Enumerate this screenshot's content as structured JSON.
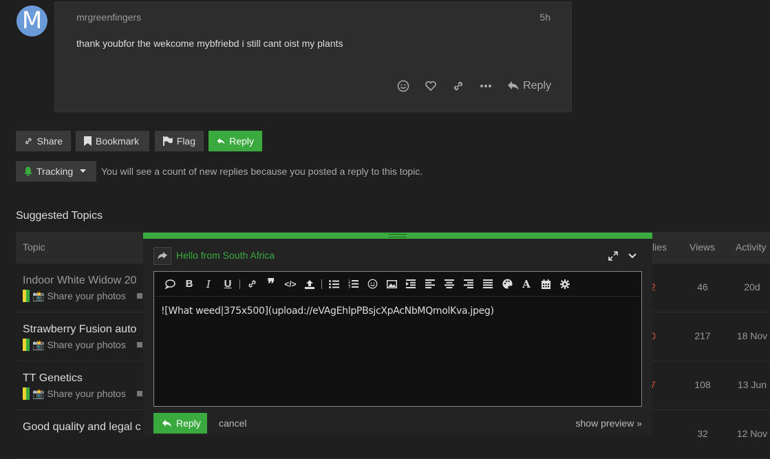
{
  "post": {
    "avatar_letter": "M",
    "username": "mrgreenfingers",
    "age": "5h",
    "body": "thank youbfor the wekcome mybfriebd i still cant oist my plants",
    "reply_label": "Reply"
  },
  "topic_buttons": {
    "share": "Share",
    "bookmark": "Bookmark",
    "flag": "Flag",
    "reply": "Reply"
  },
  "tracking": {
    "label": "Tracking",
    "note": "You will see a count of new replies because you posted a reply to this topic."
  },
  "suggested_title": "Suggested Topics",
  "table": {
    "headers": {
      "topic": "Topic",
      "replies": "lies",
      "views": "Views",
      "activity": "Activity"
    },
    "rows": [
      {
        "title": "Indoor White Widow 20",
        "category": "Share your photos",
        "replies": "2",
        "views": "46",
        "activity": "20d"
      },
      {
        "title": "Strawberry Fusion auto",
        "category": "Share your photos",
        "replies": "0",
        "views": "217",
        "activity": "18 Nov"
      },
      {
        "title": "TT Genetics",
        "category": "Share your photos",
        "replies": "7",
        "views": "108",
        "activity": "13 Jun"
      },
      {
        "title": "Good quality and legal c",
        "category": "",
        "replies": "",
        "views": "32",
        "activity": "12 Nov"
      }
    ]
  },
  "composer": {
    "reply_to_title": "Hello from South Africa",
    "editor_text": "![What weed|375x500](upload://eVAgEhlpPBsjcXpAcNbMQmolKva.jpeg)",
    "reply_label": "Reply",
    "cancel_label": "cancel",
    "preview_label": "show preview »"
  },
  "colors": {
    "accent": "#3aaa3f",
    "hot": "#e45735",
    "avatar": "#6a9bd8"
  }
}
